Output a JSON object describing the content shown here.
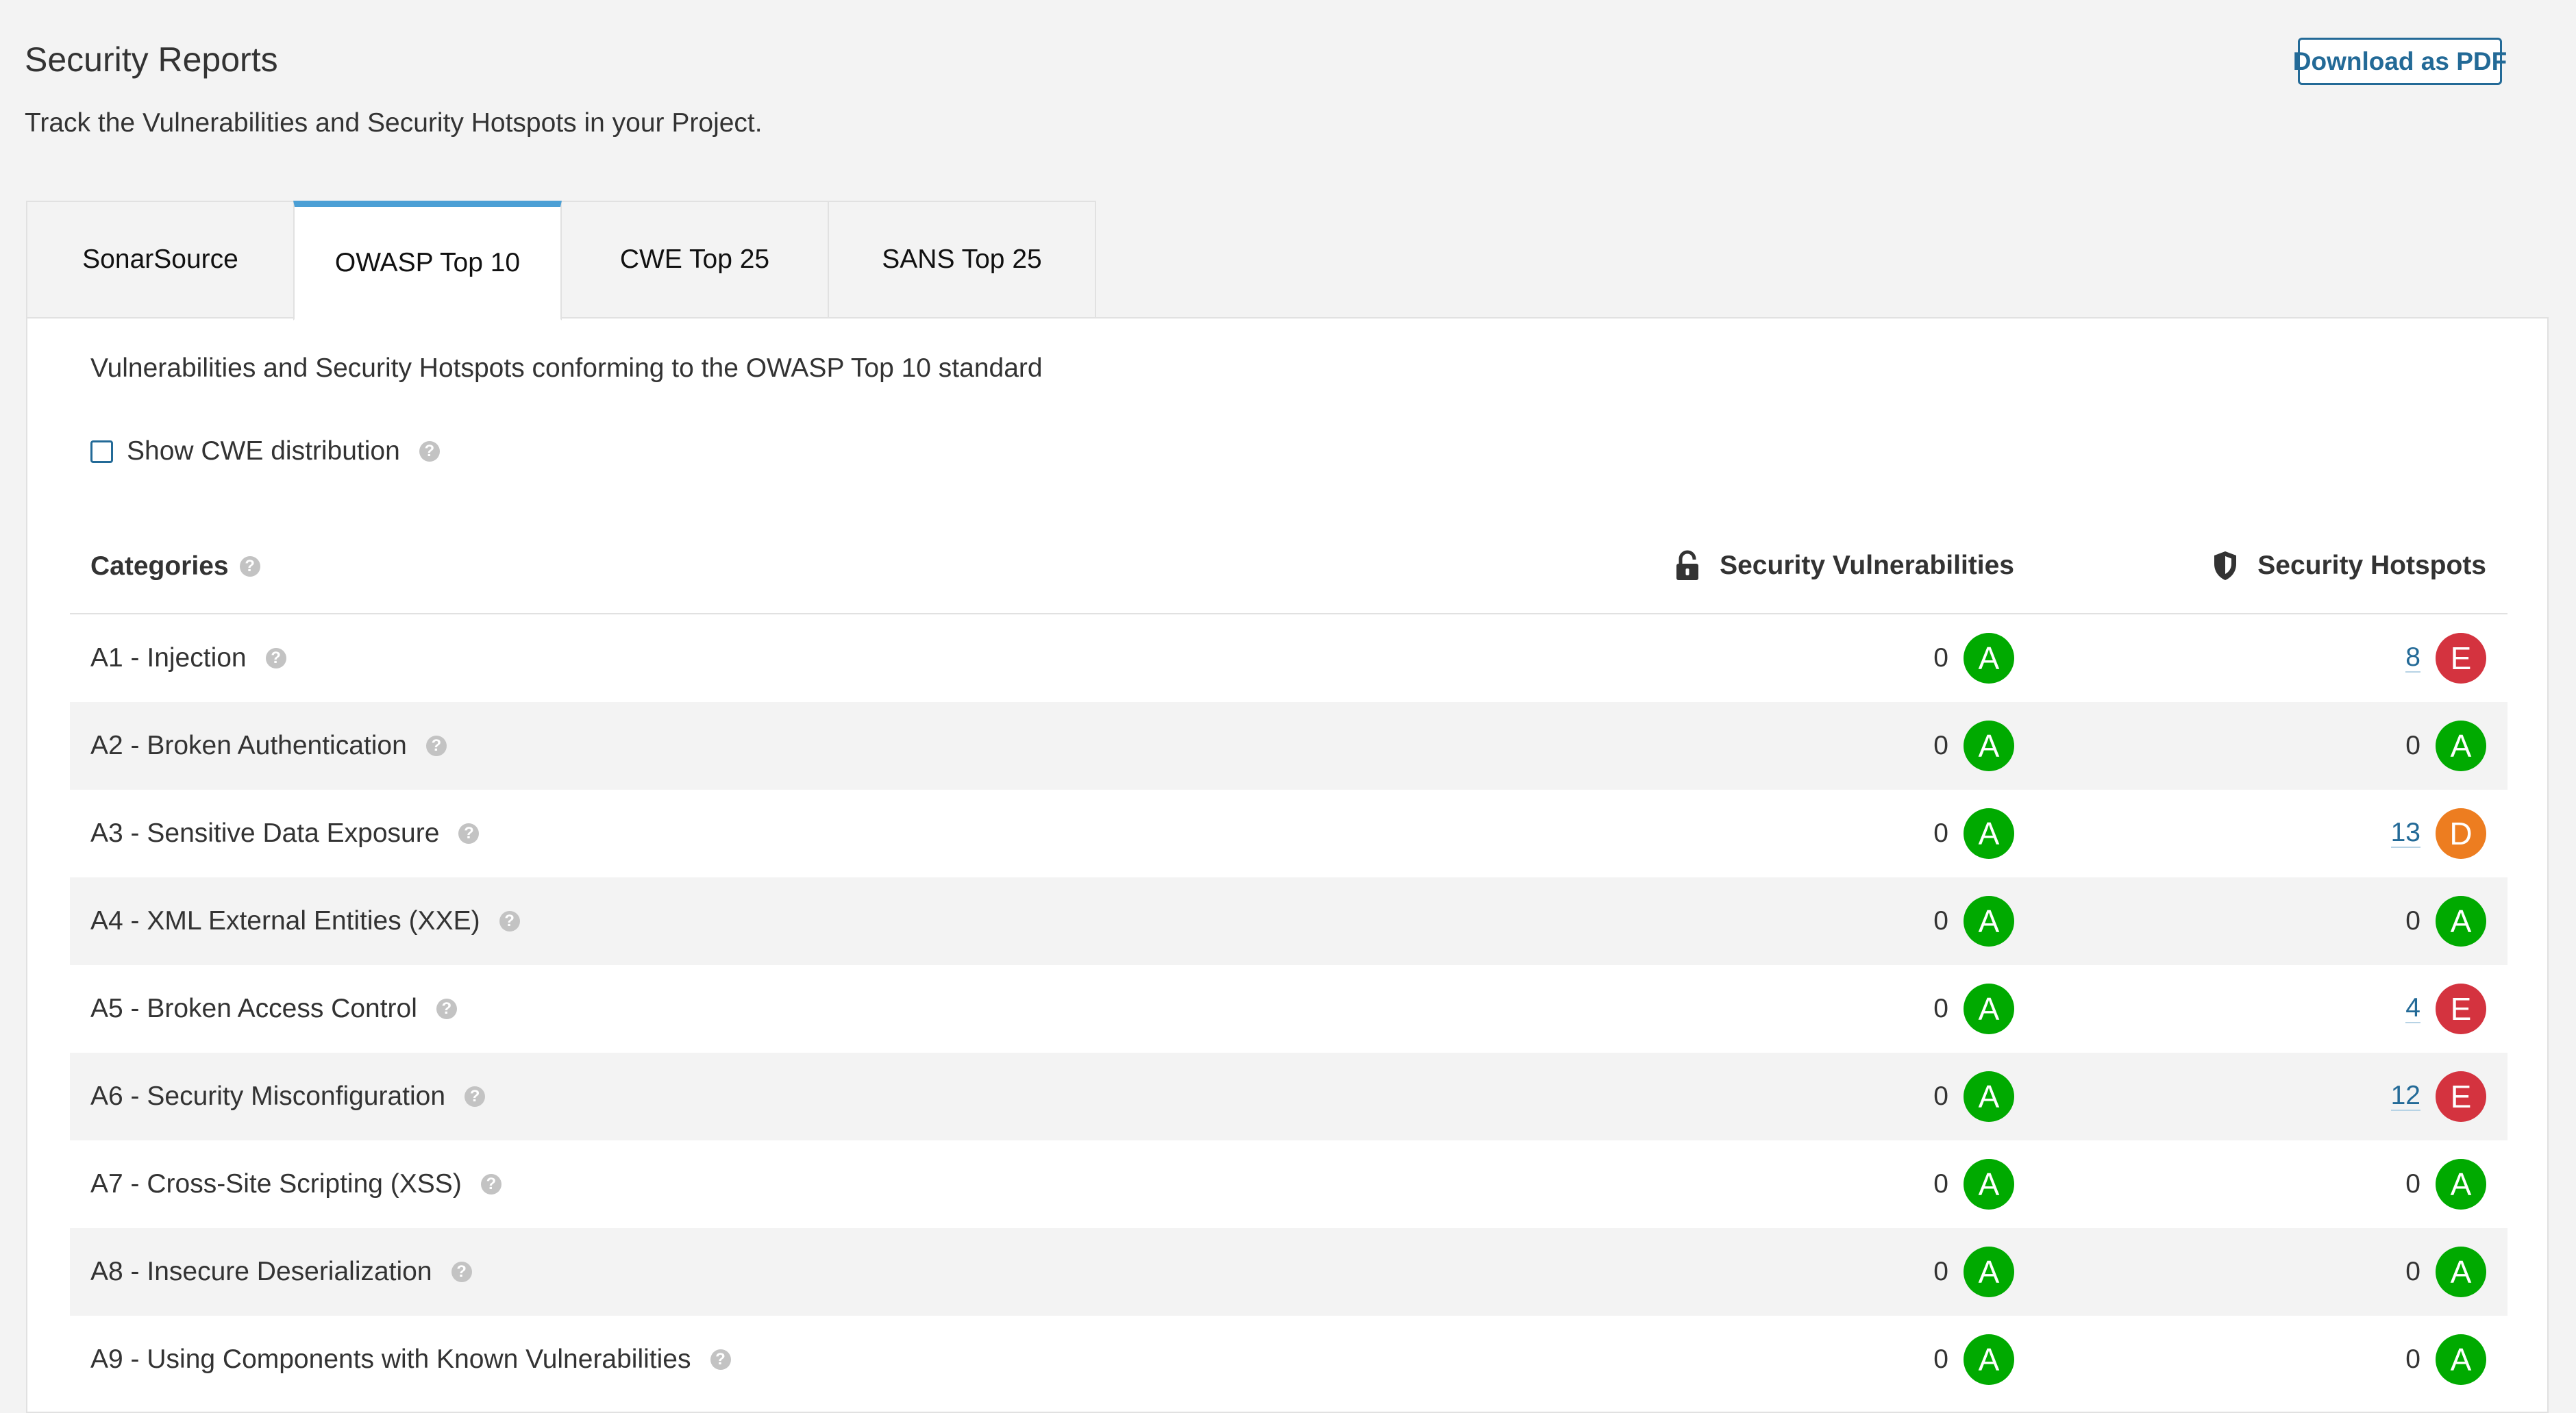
{
  "header": {
    "title": "Security Reports",
    "description": "Track the Vulnerabilities and Security Hotspots in your Project.",
    "download_label": "Download as PDF"
  },
  "tabs": [
    {
      "label": "SonarSource",
      "active": false
    },
    {
      "label": "OWASP Top 10",
      "active": true
    },
    {
      "label": "CWE Top 25",
      "active": false
    },
    {
      "label": "SANS Top 25",
      "active": false
    }
  ],
  "panel": {
    "description": "Vulnerabilities and Security Hotspots conforming to the OWASP Top 10 standard",
    "checkbox_label": "Show CWE distribution",
    "checkbox_checked": false
  },
  "table": {
    "columns": {
      "categories": "Categories",
      "vulnerabilities": "Security Vulnerabilities",
      "hotspots": "Security Hotspots"
    },
    "rows": [
      {
        "category": "A1 - Injection",
        "vulnerabilities": "0",
        "vuln_rating": "A",
        "hotspots": "8",
        "hotspot_rating": "E"
      },
      {
        "category": "A2 - Broken Authentication",
        "vulnerabilities": "0",
        "vuln_rating": "A",
        "hotspots": "0",
        "hotspot_rating": "A"
      },
      {
        "category": "A3 - Sensitive Data Exposure",
        "vulnerabilities": "0",
        "vuln_rating": "A",
        "hotspots": "13",
        "hotspot_rating": "D"
      },
      {
        "category": "A4 - XML External Entities (XXE)",
        "vulnerabilities": "0",
        "vuln_rating": "A",
        "hotspots": "0",
        "hotspot_rating": "A"
      },
      {
        "category": "A5 - Broken Access Control",
        "vulnerabilities": "0",
        "vuln_rating": "A",
        "hotspots": "4",
        "hotspot_rating": "E"
      },
      {
        "category": "A6 - Security Misconfiguration",
        "vulnerabilities": "0",
        "vuln_rating": "A",
        "hotspots": "12",
        "hotspot_rating": "E"
      },
      {
        "category": "A7 - Cross-Site Scripting (XSS)",
        "vulnerabilities": "0",
        "vuln_rating": "A",
        "hotspots": "0",
        "hotspot_rating": "A"
      },
      {
        "category": "A8 - Insecure Deserialization",
        "vulnerabilities": "0",
        "vuln_rating": "A",
        "hotspots": "0",
        "hotspot_rating": "A"
      },
      {
        "category": "A9 - Using Components with Known Vulnerabilities",
        "vulnerabilities": "0",
        "vuln_rating": "A",
        "hotspots": "0",
        "hotspot_rating": "A"
      }
    ]
  },
  "colors": {
    "rating_A": "#00aa00",
    "rating_D": "#ed7d20",
    "rating_E": "#d4333f",
    "link": "#236a97",
    "tab_active_accent": "#4b9fd5"
  },
  "icons": {
    "vulnerabilities_header": "lock-icon",
    "hotspots_header": "shield-icon",
    "help": "help-icon"
  }
}
